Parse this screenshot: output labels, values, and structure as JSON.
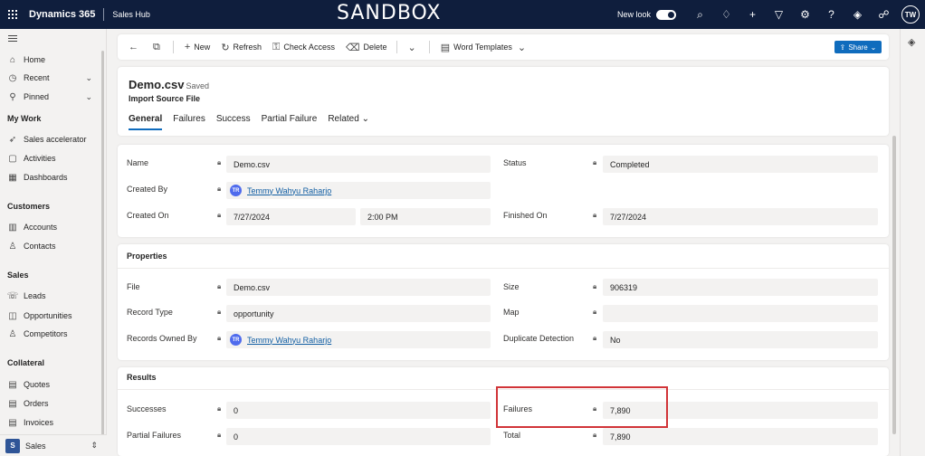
{
  "topbar": {
    "brand": "Dynamics 365",
    "app": "Sales Hub",
    "env_label": "SANDBOX",
    "new_look": "New look",
    "avatar": "TW"
  },
  "sidebar": {
    "home": "Home",
    "recent": "Recent",
    "pinned": "Pinned",
    "my_work": "My Work",
    "sales_accelerator": "Sales accelerator",
    "activities": "Activities",
    "dashboards": "Dashboards",
    "customers": "Customers",
    "accounts": "Accounts",
    "contacts": "Contacts",
    "sales": "Sales",
    "leads": "Leads",
    "opportunities": "Opportunities",
    "competitors": "Competitors",
    "collateral": "Collateral",
    "quotes": "Quotes",
    "orders": "Orders",
    "invoices": "Invoices",
    "area_badge": "S",
    "area": "Sales"
  },
  "commands": {
    "new": "New",
    "refresh": "Refresh",
    "check_access": "Check Access",
    "delete": "Delete",
    "word_templates": "Word Templates",
    "share": "Share"
  },
  "record": {
    "title": "Demo.csv",
    "saved": "- Saved",
    "entity": "Import Source File",
    "tabs": [
      "General",
      "Failures",
      "Success",
      "Partial Failure",
      "Related"
    ]
  },
  "general": {
    "name_label": "Name",
    "name_value": "Demo.csv",
    "created_by_label": "Created By",
    "created_by_initials": "TR",
    "created_by_value": "Temmy Wahyu Raharjo",
    "created_on_label": "Created On",
    "created_on_date": "7/27/2024",
    "created_on_time": "2:00 PM",
    "status_label": "Status",
    "status_value": "Completed",
    "finished_on_label": "Finished On",
    "finished_on_value": "7/27/2024"
  },
  "properties": {
    "title": "Properties",
    "file_label": "File",
    "file_value": "Demo.csv",
    "record_type_label": "Record Type",
    "record_type_value": "opportunity",
    "owned_by_label": "Records Owned By",
    "owned_by_initials": "TR",
    "owned_by_value": "Temmy Wahyu Raharjo",
    "size_label": "Size",
    "size_value": "906319",
    "map_label": "Map",
    "map_value": "",
    "dup_label": "Duplicate Detection",
    "dup_value": "No"
  },
  "results": {
    "title": "Results",
    "successes_label": "Successes",
    "successes_value": "0",
    "partial_label": "Partial Failures",
    "partial_value": "0",
    "failures_label": "Failures",
    "failures_value": "7,890",
    "total_label": "Total",
    "total_value": "7,890"
  },
  "colors": {
    "topbar": "#0f1e3d",
    "accent": "#0f6cbd",
    "highlight": "#d13438"
  }
}
